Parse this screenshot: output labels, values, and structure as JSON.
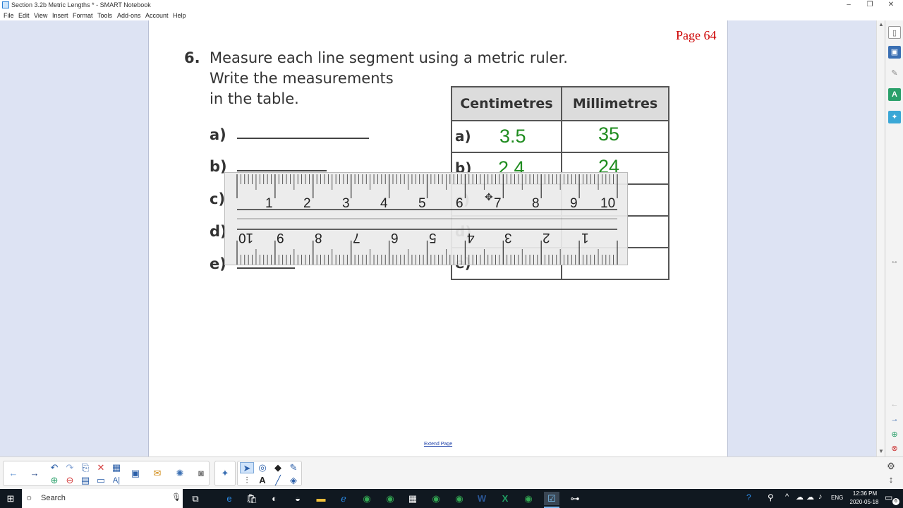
{
  "window": {
    "title": "Section 3.2b Metric Lengths * - SMART Notebook",
    "controls": [
      "–",
      "❐",
      "✕"
    ]
  },
  "menu": [
    "File",
    "Edit",
    "View",
    "Insert",
    "Format",
    "Tools",
    "Add-ons",
    "Account",
    "Help"
  ],
  "page": {
    "page_label": "Page 64",
    "problem_number": "6.",
    "instruction_lines": [
      "Measure each line segment using a metric ruler.",
      "Write the measurements",
      "in the table."
    ],
    "segment_labels": [
      "a)",
      "b)",
      "c)",
      "d)",
      "e)"
    ],
    "table": {
      "headers": [
        "Centimetres",
        "Millimetres"
      ],
      "rows": [
        {
          "label": "a)",
          "cm": "3.5",
          "mm": "35"
        },
        {
          "label": "b)",
          "cm": "2.4",
          "mm": "24"
        },
        {
          "label": "c)",
          "cm": "",
          "mm": ""
        },
        {
          "label": "d)",
          "cm": "",
          "mm": ""
        },
        {
          "label": "e)",
          "cm": "",
          "mm": ""
        }
      ]
    },
    "extend_page_link": "Extend Page"
  },
  "ruler": {
    "top_numbers": [
      "1",
      "2",
      "3",
      "4",
      "5",
      "6",
      "7",
      "8",
      "9",
      "10"
    ],
    "bottom_numbers": [
      "10",
      "9",
      "8",
      "7",
      "6",
      "5",
      "4",
      "3",
      "2",
      "1"
    ]
  },
  "taskbar": {
    "search_placeholder": "Search",
    "time": "12:36 PM",
    "date": "2020-05-18",
    "language": "ENG",
    "notification_count": "6"
  },
  "colors": {
    "handwriting": "#1f8c1f",
    "page_label": "#cc0000",
    "workspace": "#dde3f3"
  }
}
